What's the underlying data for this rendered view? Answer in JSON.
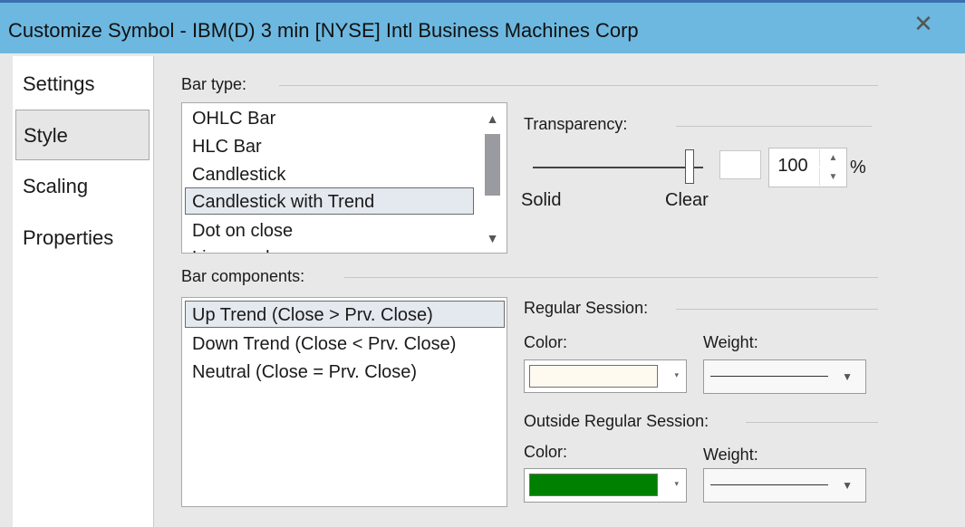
{
  "window": {
    "title": "Customize Symbol - IBM(D) 3 min [NYSE] Intl Business Machines Corp",
    "close_glyph": "✕"
  },
  "sidebar": {
    "items": [
      {
        "label": "Settings"
      },
      {
        "label": "Style"
      },
      {
        "label": "Scaling"
      },
      {
        "label": "Properties"
      }
    ],
    "selected": "Style"
  },
  "bar_type": {
    "label": "Bar type:",
    "options": [
      "OHLC Bar",
      "HLC Bar",
      "Candlestick",
      "Candlestick with Trend",
      "Dot on close",
      "Line on close"
    ],
    "selected": "Candlestick with Trend"
  },
  "transparency": {
    "label": "Transparency:",
    "value": "100",
    "unit": "%",
    "min_label": "Solid",
    "max_label": "Clear",
    "level": 1.0
  },
  "bar_components": {
    "label": "Bar components:",
    "items": [
      "Up Trend (Close > Prv. Close)",
      "Down Trend (Close < Prv. Close)",
      "Neutral (Close = Prv. Close)"
    ],
    "selected": "Up Trend (Close > Prv. Close)"
  },
  "regular_session": {
    "label": "Regular Session:",
    "color_label": "Color:",
    "weight_label": "Weight:",
    "color": "#fffaf0"
  },
  "outside_session": {
    "label": "Outside Regular Session:",
    "color_label": "Color:",
    "weight_label": "Weight:",
    "color": "#008000"
  },
  "icons": {
    "scroll_up": "▲",
    "scroll_down": "▼",
    "spin_up": "▲",
    "spin_down": "▼",
    "dropdown_small": "▾",
    "dropdown": "▼"
  }
}
